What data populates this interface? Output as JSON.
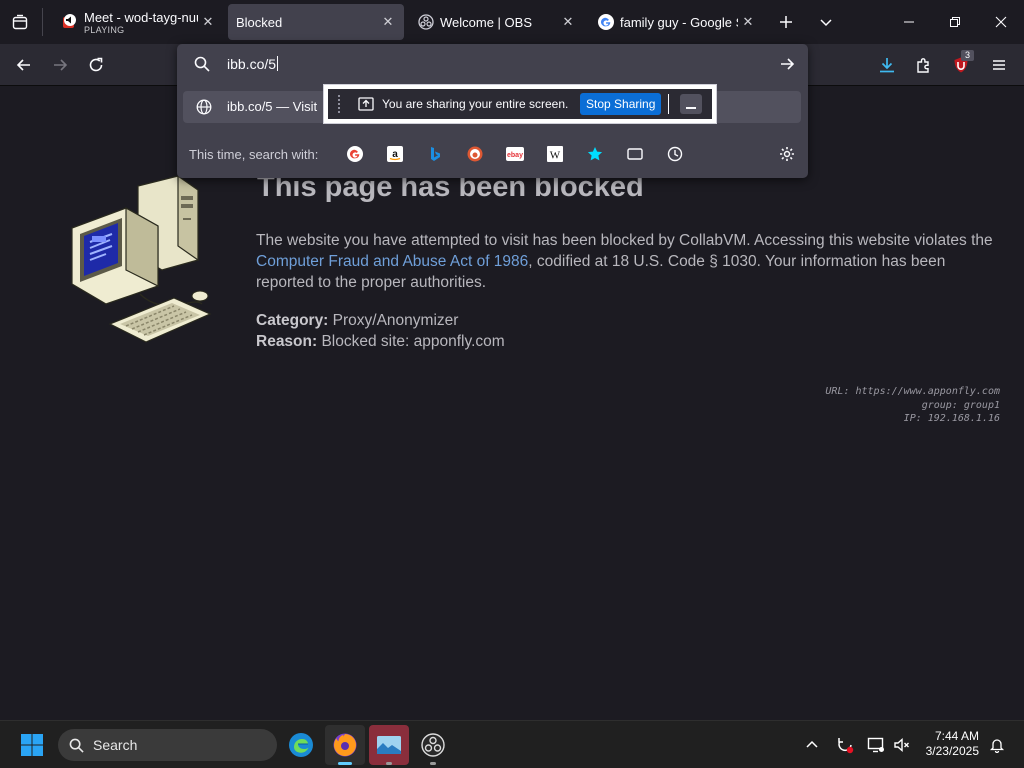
{
  "tabs": [
    {
      "title": "Meet - wod-tayg-nuu",
      "subtitle": "PLAYING"
    },
    {
      "title": "Blocked"
    },
    {
      "title": "Welcome | OBS"
    },
    {
      "title": "family guy - Google Se"
    }
  ],
  "urlbar": {
    "value": "ibb.co/5",
    "suggestion": "ibb.co/5 — Visit",
    "oneoff_label": "This time, search with:"
  },
  "extension_badge": "3",
  "sharing": {
    "text": "You are sharing your entire screen.",
    "stop_label": "Stop Sharing"
  },
  "page": {
    "heading": "This page has been blocked",
    "desc_before": "The website you have attempted to visit has been blocked by CollabVM. Accessing this website violates the ",
    "desc_link": "Computer Fraud and Abuse Act of 1986",
    "desc_after": ", codified at 18 U.S. Code § 1030. Your information has been reported to the proper authorities.",
    "category_label": "Category:",
    "category_value": "Proxy/Anonymizer",
    "reason_label": "Reason:",
    "reason_value": "Blocked site: apponfly.com",
    "meta_url": "URL: https://www.apponfly.com",
    "meta_group": "group: group1",
    "meta_ip": "IP: 192.168.1.16"
  },
  "taskbar": {
    "search_label": "Search",
    "time": "7:44 AM",
    "date": "3/23/2025"
  },
  "colors": {
    "accent_blue": "#0b6ed6",
    "link": "#6f9fd9",
    "download_arrow": "#3fb9f0",
    "ublock_red": "#c0181f"
  }
}
